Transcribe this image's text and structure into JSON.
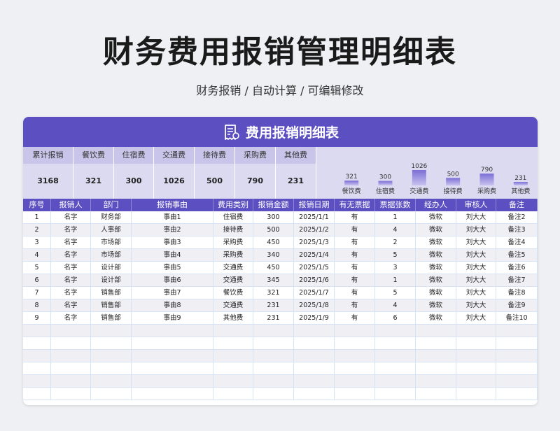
{
  "header": {
    "title": "财务费用报销管理明细表",
    "subtitle": "财务报销 / 自动计算 / 可编辑修改"
  },
  "banner": {
    "title": "费用报销明细表"
  },
  "summary": {
    "labels": [
      "累计报销",
      "餐饮费",
      "住宿费",
      "交通费",
      "接待费",
      "采购费",
      "其他费"
    ],
    "values": [
      "3168",
      "321",
      "300",
      "1026",
      "500",
      "790",
      "231"
    ]
  },
  "chart_data": {
    "type": "bar",
    "categories": [
      "餐饮费",
      "住宿费",
      "交通费",
      "接待费",
      "采购费",
      "其他费"
    ],
    "values": [
      321,
      300,
      1026,
      500,
      790,
      231
    ],
    "title": "",
    "xlabel": "",
    "ylabel": "",
    "grid": false
  },
  "table": {
    "columns": [
      "序号",
      "报销人",
      "部门",
      "报销事由",
      "费用类别",
      "报销金额",
      "报销日期",
      "有无票据",
      "票据张数",
      "经办人",
      "审核人",
      "备注"
    ],
    "rows": [
      [
        "1",
        "名字",
        "财务部",
        "事由1",
        "住宿费",
        "300",
        "2025/1/1",
        "有",
        "1",
        "微软",
        "刘大大",
        "备注2"
      ],
      [
        "2",
        "名字",
        "人事部",
        "事由2",
        "接待费",
        "500",
        "2025/1/2",
        "有",
        "4",
        "微软",
        "刘大大",
        "备注3"
      ],
      [
        "3",
        "名字",
        "市场部",
        "事由3",
        "采购费",
        "450",
        "2025/1/3",
        "有",
        "2",
        "微软",
        "刘大大",
        "备注4"
      ],
      [
        "4",
        "名字",
        "市场部",
        "事由4",
        "采购费",
        "340",
        "2025/1/4",
        "有",
        "5",
        "微软",
        "刘大大",
        "备注5"
      ],
      [
        "5",
        "名字",
        "设计部",
        "事由5",
        "交通费",
        "450",
        "2025/1/5",
        "有",
        "3",
        "微软",
        "刘大大",
        "备注6"
      ],
      [
        "6",
        "名字",
        "设计部",
        "事由6",
        "交通费",
        "345",
        "2025/1/6",
        "有",
        "1",
        "微软",
        "刘大大",
        "备注7"
      ],
      [
        "7",
        "名字",
        "销售部",
        "事由7",
        "餐饮费",
        "321",
        "2025/1/7",
        "有",
        "5",
        "微软",
        "刘大大",
        "备注8"
      ],
      [
        "8",
        "名字",
        "销售部",
        "事由8",
        "交通费",
        "231",
        "2025/1/8",
        "有",
        "4",
        "微软",
        "刘大大",
        "备注9"
      ],
      [
        "9",
        "名字",
        "销售部",
        "事由9",
        "其他费",
        "231",
        "2025/1/9",
        "有",
        "6",
        "微软",
        "刘大大",
        "备注10"
      ]
    ],
    "empty_rows": 6
  },
  "colors": {
    "accent": "#5b4fc2",
    "summary_bg": "#dcdaf0",
    "summary_label_bg": "#c9c5ea"
  }
}
